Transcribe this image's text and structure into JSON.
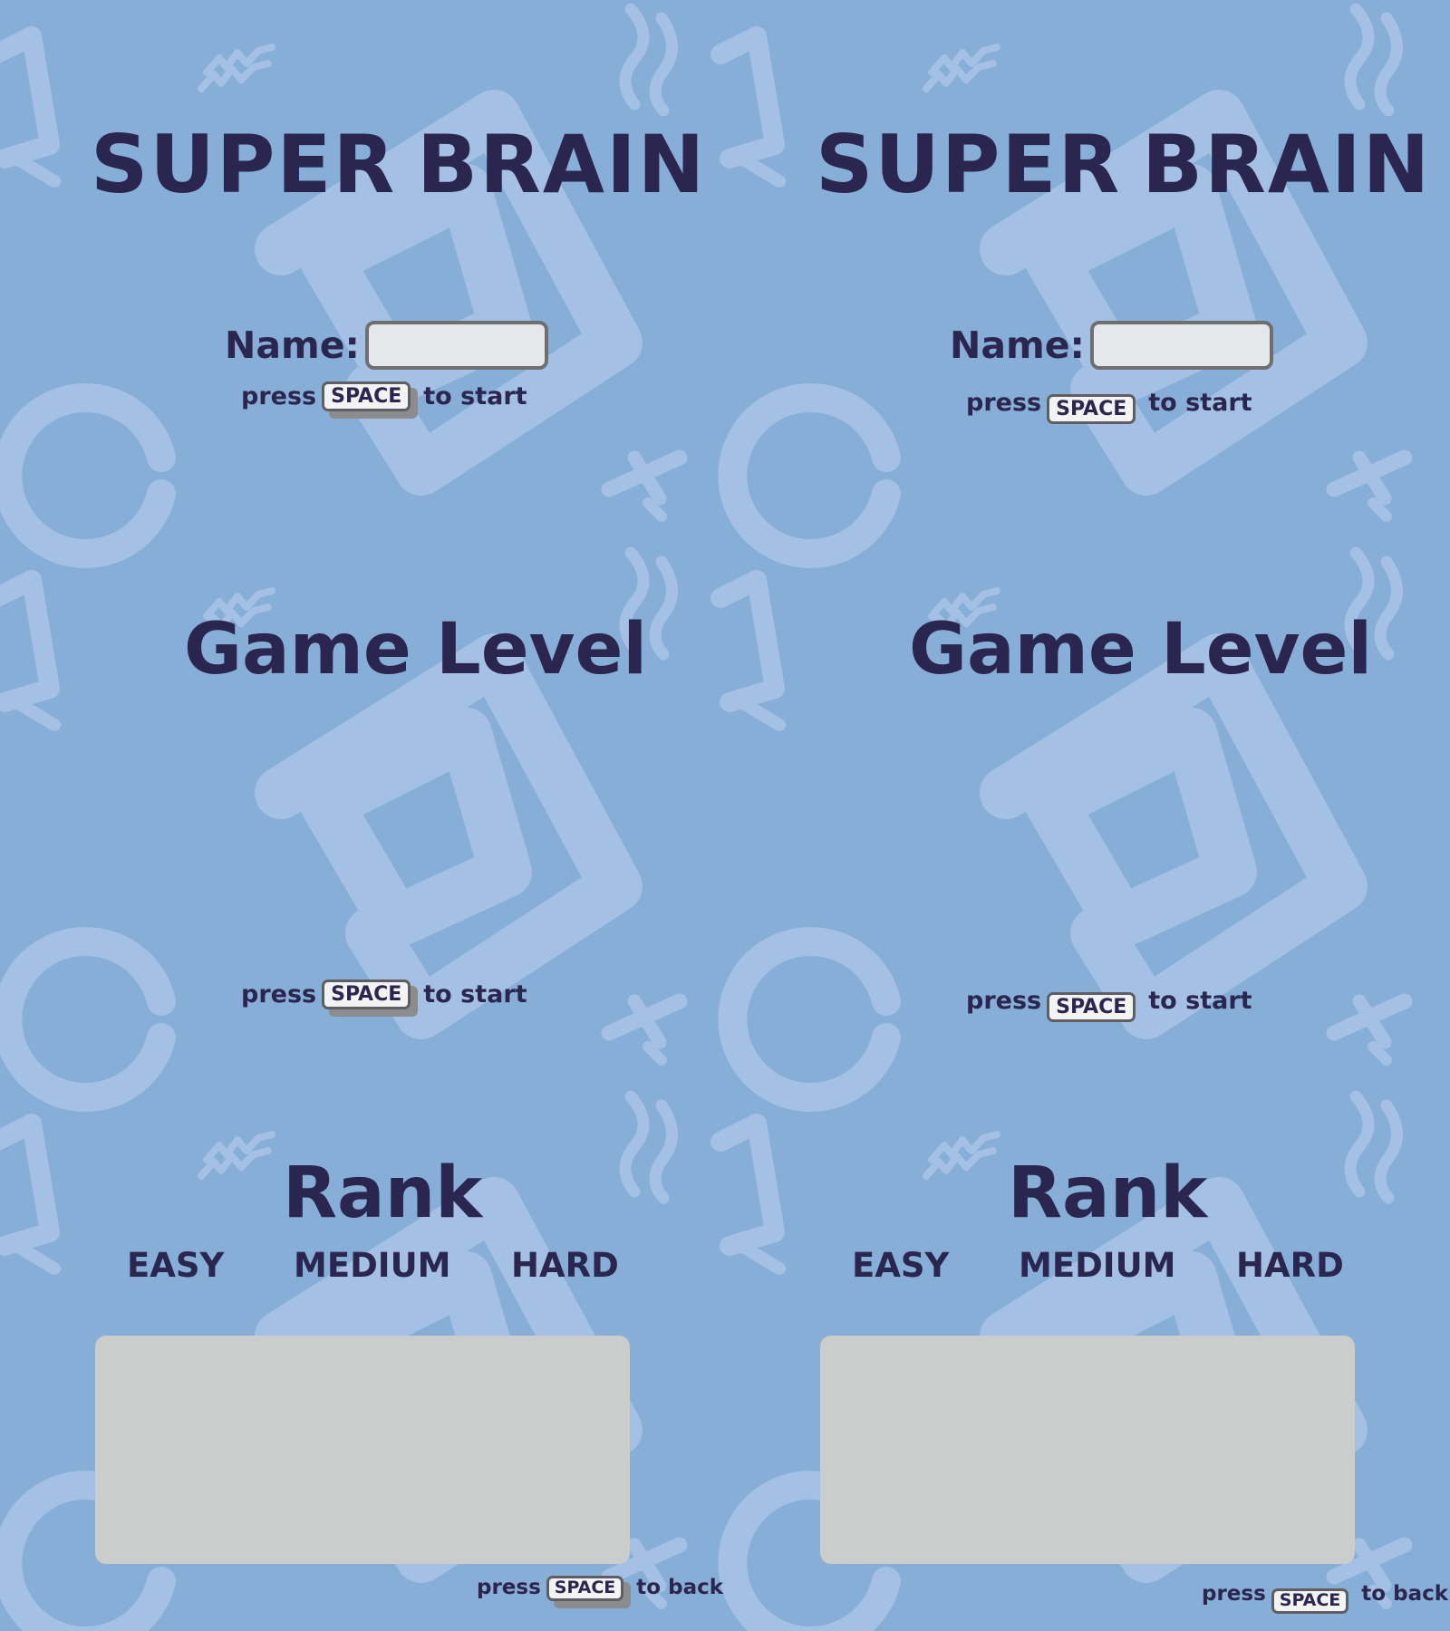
{
  "colors": {
    "background": "#86aed6",
    "pattern": "#a4c0e4",
    "text": "#2b2650",
    "input_fill": "#e6e7e8",
    "input_border": "#6f6f72",
    "panel": "#cbcdcd"
  },
  "screens": [
    {
      "title": {
        "word1": "SUPER",
        "word2": "BRAIN"
      },
      "name_label": "Name:",
      "name_value": "",
      "start_hint": {
        "prefix": "press",
        "key": "SPACE",
        "suffix": "to start"
      },
      "level_title": "Game Level",
      "level_hint": {
        "prefix": "press",
        "key": "SPACE",
        "suffix": "to start"
      },
      "rank_title": "Rank",
      "rank_tabs": [
        "EASY",
        "MEDIUM",
        "HARD"
      ],
      "back_hint": {
        "prefix": "press",
        "key": "SPACE",
        "suffix": "to back"
      }
    },
    {
      "title": {
        "word1": "SUPER",
        "word2": "BRAIN"
      },
      "name_label": "Name:",
      "name_value": "",
      "start_hint": {
        "prefix": "press",
        "key": "SPACE",
        "suffix": "to start"
      },
      "level_title": "Game Level",
      "level_hint": {
        "prefix": "press",
        "key": "SPACE",
        "suffix": "to start"
      },
      "rank_title": "Rank",
      "rank_tabs": [
        "EASY",
        "MEDIUM",
        "HARD"
      ],
      "back_hint": {
        "prefix": "press",
        "key": "SPACE",
        "suffix": "to back"
      }
    }
  ]
}
